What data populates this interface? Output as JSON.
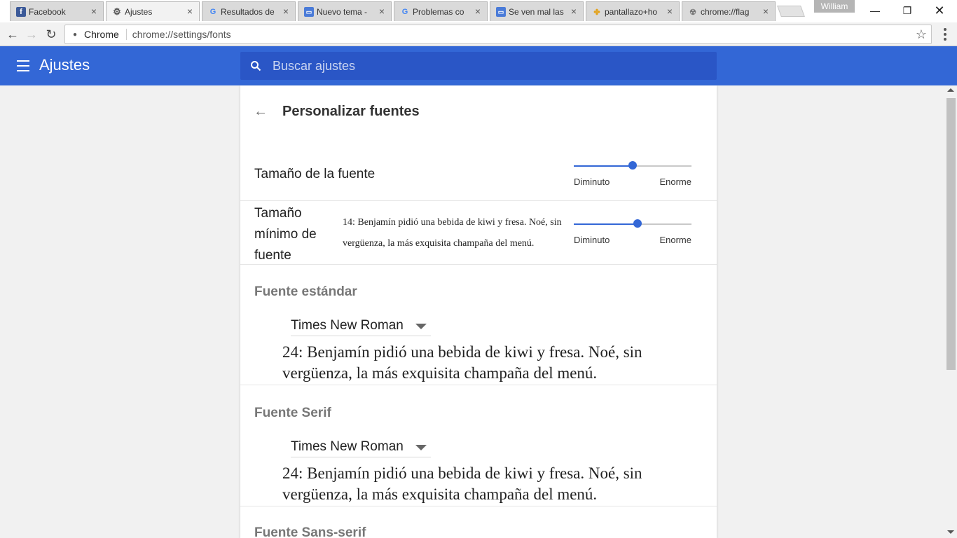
{
  "browser": {
    "tabs": [
      {
        "title": "Facebook",
        "icon": "facebook-icon",
        "active": false
      },
      {
        "title": "Ajustes",
        "icon": "gear-icon",
        "active": true
      },
      {
        "title": "Resultados de",
        "icon": "google-icon",
        "active": false
      },
      {
        "title": "Nuevo tema -",
        "icon": "chat-icon",
        "active": false
      },
      {
        "title": "Problemas co",
        "icon": "google-icon",
        "active": false
      },
      {
        "title": "Se ven mal las",
        "icon": "chat-icon",
        "active": false
      },
      {
        "title": "pantallazo+ho",
        "icon": "pinwheel-icon",
        "active": false
      },
      {
        "title": "chrome://flag",
        "icon": "flags-icon",
        "active": false
      }
    ],
    "profile_name": "William",
    "omnibox_chip": "Chrome",
    "url": "chrome://settings/fonts"
  },
  "settings": {
    "header_title": "Ajustes",
    "search_placeholder": "Buscar ajustes",
    "page_title": "Personalizar fuentes",
    "font_size": {
      "label": "Tamaño de la fuente",
      "min_label": "Diminuto",
      "max_label": "Enorme",
      "level": 0.5
    },
    "min_font_size": {
      "label_lines": [
        "Tamaño",
        "mínimo de",
        "fuente"
      ],
      "sample": "14: Benjamín pidió una bebida de kiwi y fresa. Noé, sin vergüenza, la más exquisita champaña del menú.",
      "min_label": "Diminuto",
      "max_label": "Enorme",
      "level": 0.54
    },
    "standard_font": {
      "title": "Fuente estándar",
      "value": "Times New Roman",
      "sample": "24: Benjamín pidió una bebida de kiwi y fresa. Noé, sin vergüenza, la más exquisita champaña del menú."
    },
    "serif_font": {
      "title": "Fuente Serif",
      "value": "Times New Roman",
      "sample": "24: Benjamín pidió una bebida de kiwi y fresa. Noé, sin vergüenza, la más exquisita champaña del menú."
    },
    "sans_serif_font": {
      "title": "Fuente Sans-serif"
    }
  },
  "colors": {
    "header": "#3367d6",
    "search_bg": "#2a56c6",
    "accent": "#3367d6"
  }
}
